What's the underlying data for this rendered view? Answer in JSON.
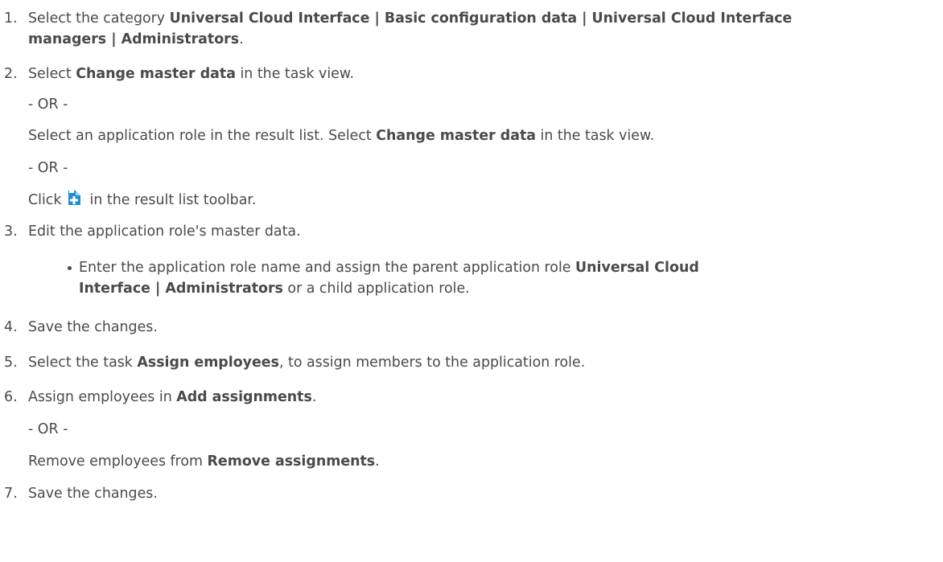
{
  "steps": [
    {
      "num": "1.",
      "p1": "Select the category ",
      "b1": "Universal Cloud Interface | Basic configuration data | Universal Cloud Interface",
      "b2": "managers | Administrators",
      "p2": "."
    },
    {
      "num": "2.",
      "p1": "Select ",
      "b1": "Change master data",
      "p2": " in the task view.",
      "or1": "- OR -",
      "alt1_p1": "Select an application role in the result list. Select ",
      "alt1_b1": "Change master data",
      "alt1_p2": " in the task view.",
      "or2": "- OR -",
      "alt2_p1": "Click ",
      "alt2_icon": "add-new-icon",
      "alt2_p2": " in the result list toolbar."
    },
    {
      "num": "3.",
      "p1": "Edit the application role's master data.",
      "bullet_p1": "Enter the application role name and assign the parent application role ",
      "bullet_b1": "Universal Cloud",
      "bullet_b2": "Interface | Administrators",
      "bullet_p2": " or a child application role."
    },
    {
      "num": "4.",
      "p1": "Save the changes."
    },
    {
      "num": "5.",
      "p1": "Select the task ",
      "b1": "Assign employees",
      "p2": ", to assign members to the application role."
    },
    {
      "num": "6.",
      "p1": "Assign employees in ",
      "b1": "Add assignments",
      "p2": ".",
      "or1": "- OR -",
      "alt1_p1": "Remove employees from ",
      "alt1_b1": "Remove assignments",
      "alt1_p2": "."
    },
    {
      "num": "7.",
      "p1": "Save the changes."
    }
  ],
  "colors": {
    "text": "#4a4a4a",
    "icon_blue": "#1e8fd6"
  }
}
